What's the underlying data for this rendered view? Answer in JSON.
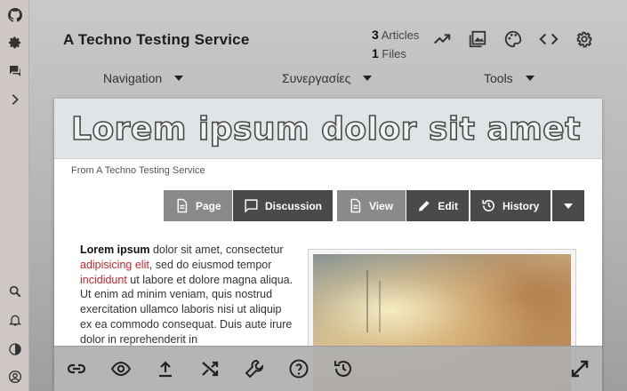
{
  "sidebar": {
    "icons": [
      "github-icon",
      "settings-cog-icon",
      "chat-icon",
      "chevron-right-icon",
      "search-icon",
      "bell-icon",
      "contrast-icon",
      "account-icon"
    ]
  },
  "header": {
    "site_title": "A Techno Testing Service",
    "articles_count": "3",
    "articles_label": "Articles",
    "files_count": "1",
    "files_label": "Files",
    "icons": [
      "trending-icon",
      "image-gallery-icon",
      "palette-icon",
      "code-icon",
      "gear-icon"
    ]
  },
  "nav": {
    "menus": [
      {
        "label": "Navigation"
      },
      {
        "label": "Συνεργασίες"
      },
      {
        "label": "Tools"
      }
    ]
  },
  "article": {
    "title": "Lorem ipsum dolor sit amet",
    "from": "From A Techno Testing Service",
    "tabs": {
      "page": "Page",
      "discussion": "Discussion",
      "view": "View",
      "edit": "Edit",
      "history": "History"
    },
    "lead_bold": "Lorem ipsum",
    "lead_1": " dolor sit amet, consectetur ",
    "lead_link1": "adipisicing elit",
    "lead_2": ", sed do eiusmod tempor ",
    "lead_link2": "incididunt",
    "lead_3": " ut labore et dolore magna aliqua. Ut enim ad minim veniam, quis nostrud exercitation ullamco laboris nisi ut aliquip ex ea commodo consequat.  Duis aute irure dolor in reprehenderit in"
  },
  "bottombar": {
    "icons": [
      "link-icon",
      "eye-icon",
      "upload-icon",
      "shuffle-icon",
      "wrench-icon",
      "help-icon",
      "history-icon",
      "expand-icon"
    ]
  },
  "colors": {
    "accent_link": "#c4272f",
    "dark_button": "#4a4a4a",
    "light_button": "#8a8a8a"
  }
}
